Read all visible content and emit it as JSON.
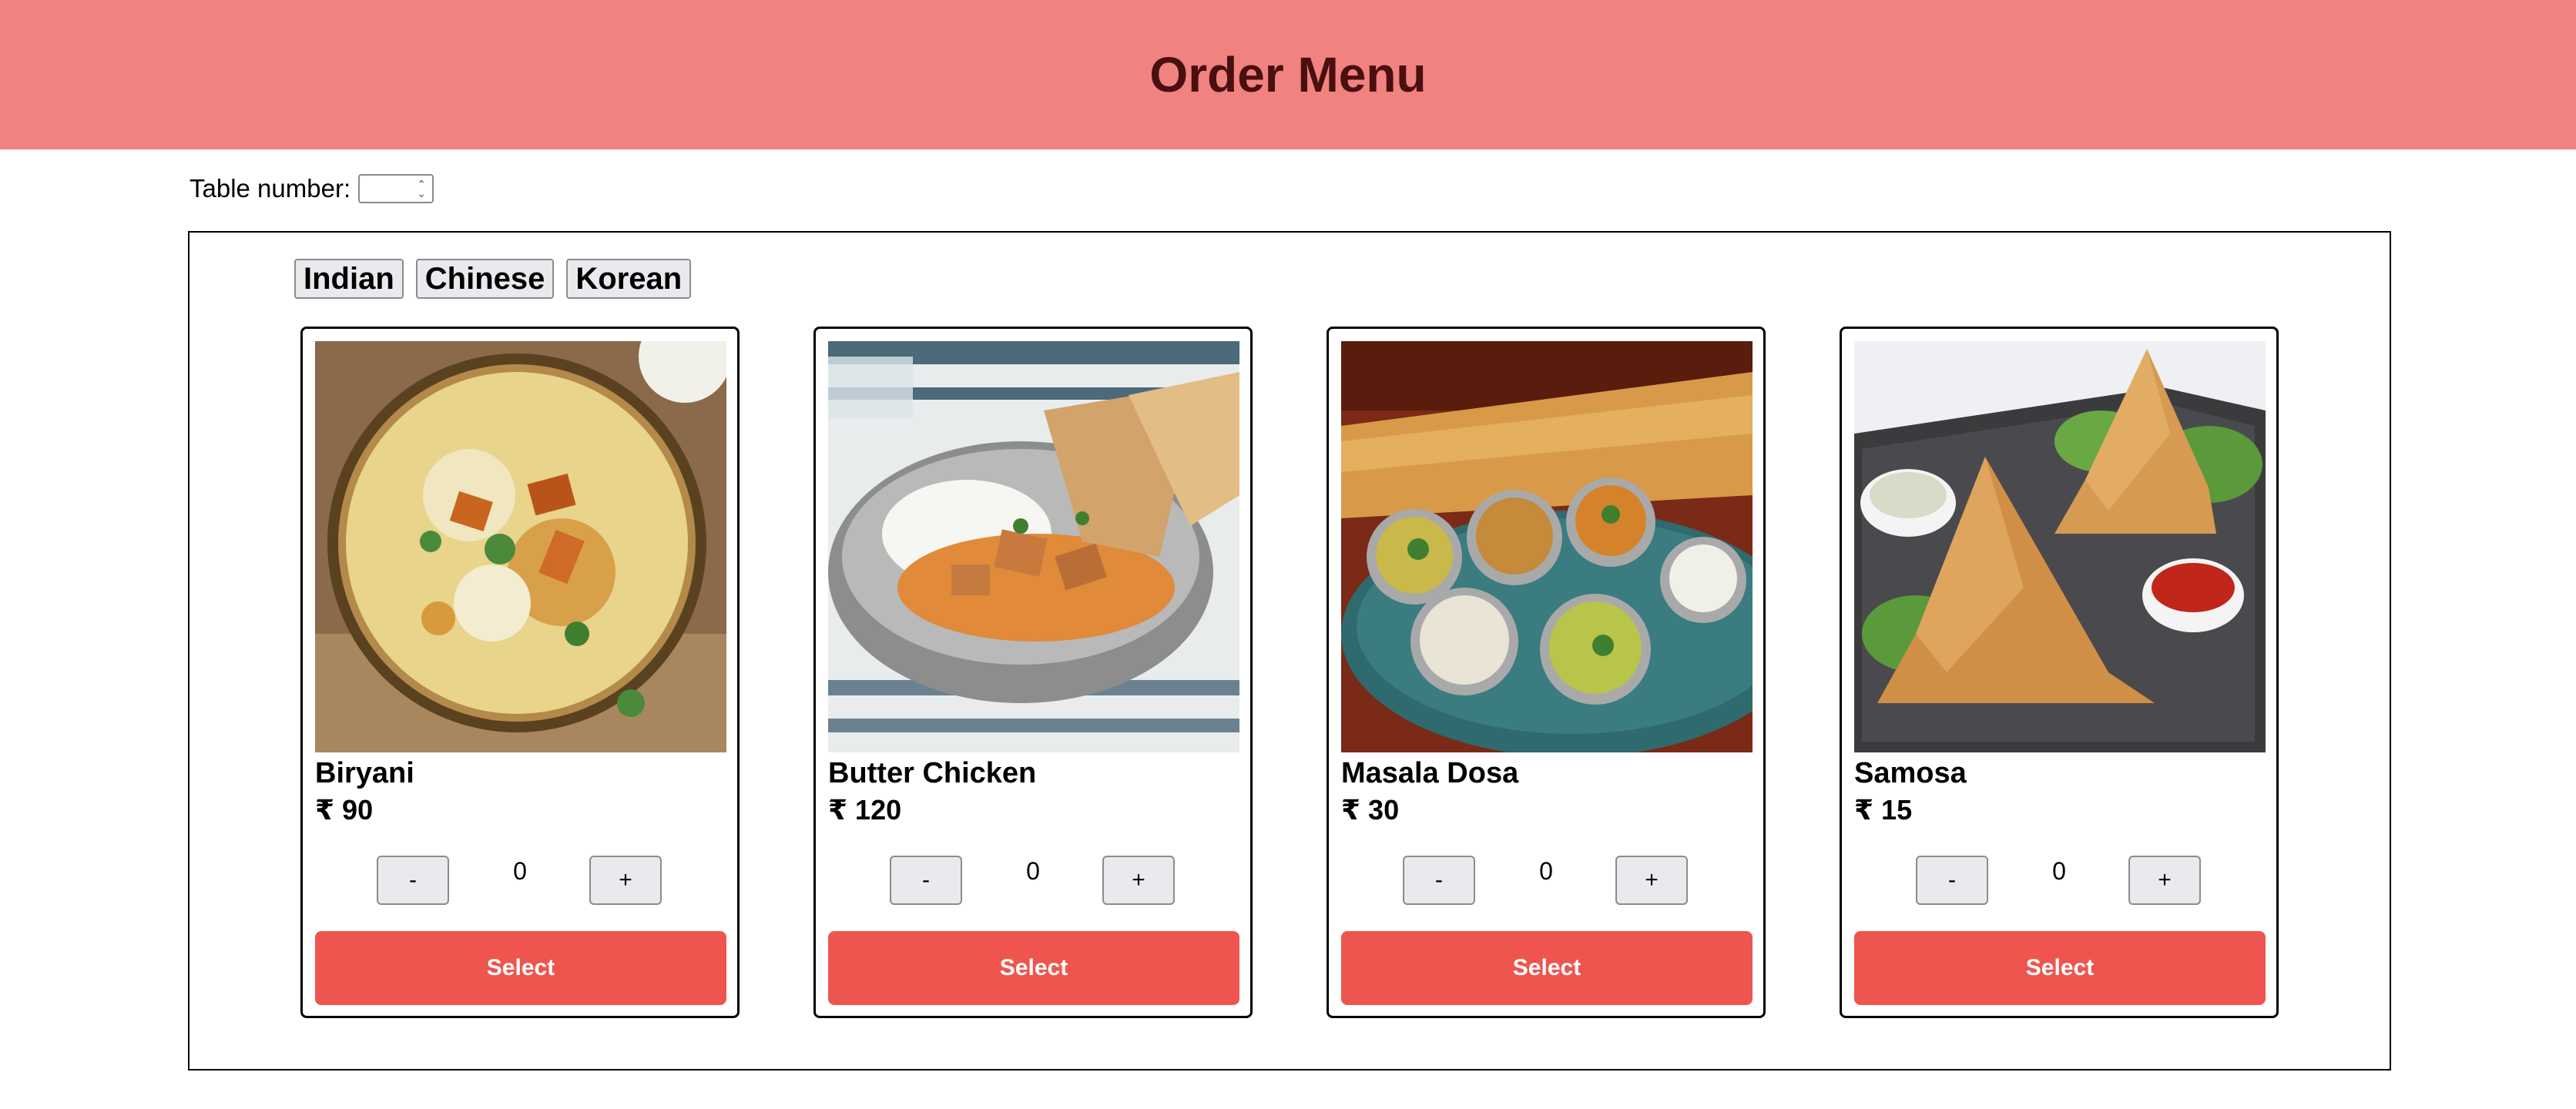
{
  "header": {
    "title": "Order Menu"
  },
  "table": {
    "label": "Table number:",
    "value": ""
  },
  "tabs": [
    {
      "label": "Indian"
    },
    {
      "label": "Chinese"
    },
    {
      "label": "Korean"
    }
  ],
  "items": [
    {
      "name": "Biryani",
      "price": "₹ 90",
      "qty": "0",
      "minus": "-",
      "plus": "+",
      "select": "Select",
      "image": "biryani-photo"
    },
    {
      "name": "Butter Chicken",
      "price": "₹ 120",
      "qty": "0",
      "minus": "-",
      "plus": "+",
      "select": "Select",
      "image": "butter-chicken-photo"
    },
    {
      "name": "Masala Dosa",
      "price": "₹ 30",
      "qty": "0",
      "minus": "-",
      "plus": "+",
      "select": "Select",
      "image": "masala-dosa-photo"
    },
    {
      "name": "Samosa",
      "price": "₹ 15",
      "qty": "0",
      "minus": "-",
      "plus": "+",
      "select": "Select",
      "image": "samosa-photo"
    }
  ],
  "colors": {
    "header_bg": "#f08280",
    "header_text": "#4a0f0f",
    "select_button": "#ee554f"
  }
}
